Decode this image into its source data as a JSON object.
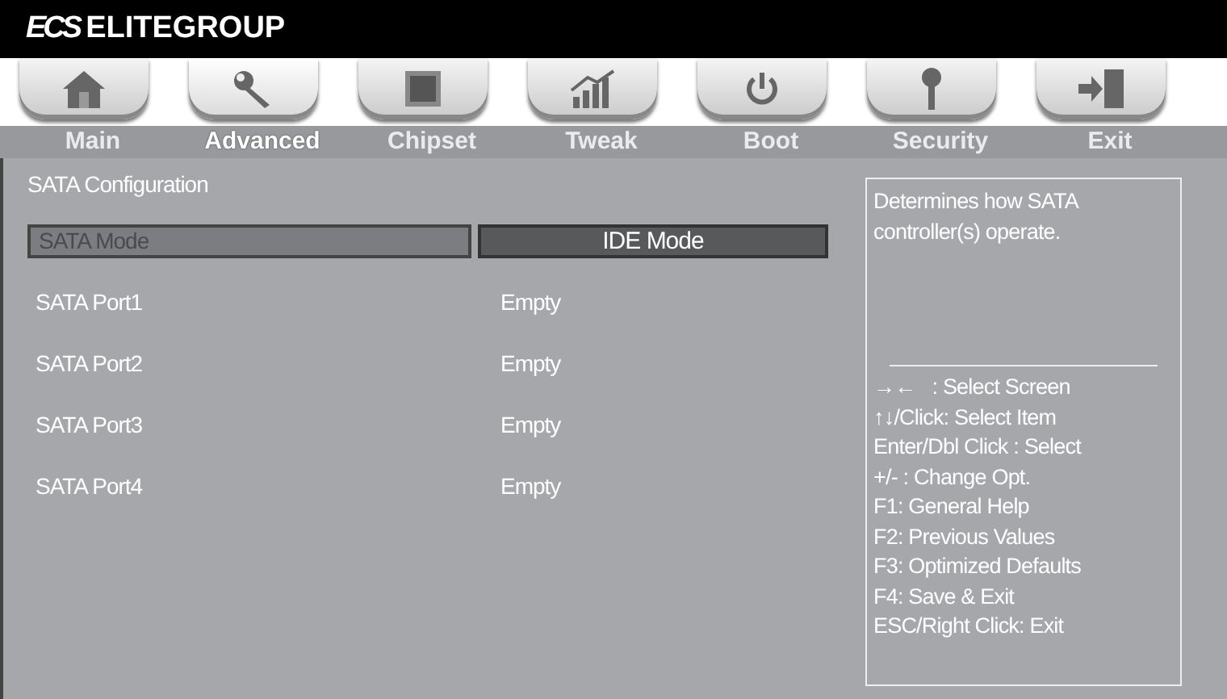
{
  "header": {
    "logo_mark": "ECS",
    "brand": "ELITEGROUP"
  },
  "tabs": [
    {
      "label": "Main",
      "selected": false
    },
    {
      "label": "Advanced",
      "selected": true
    },
    {
      "label": "Chipset",
      "selected": false
    },
    {
      "label": "Tweak",
      "selected": false
    },
    {
      "label": "Boot",
      "selected": false
    },
    {
      "label": "Security",
      "selected": false
    },
    {
      "label": "Exit",
      "selected": false
    }
  ],
  "section_title": "SATA Configuration",
  "settings": [
    {
      "label": "SATA Mode",
      "value": "IDE Mode",
      "selected": true
    },
    {
      "label": "SATA Port1",
      "value": "Empty",
      "selected": false
    },
    {
      "label": "SATA Port2",
      "value": "Empty",
      "selected": false
    },
    {
      "label": "SATA Port3",
      "value": "Empty",
      "selected": false
    },
    {
      "label": "SATA Port4",
      "value": "Empty",
      "selected": false
    }
  ],
  "help": {
    "description": "Determines how SATA controller(s) operate.",
    "keys": [
      "→←   : Select Screen",
      "↑↓/Click: Select Item",
      "Enter/Dbl Click : Select",
      "+/- : Change Opt.",
      "F1: General Help",
      "F2: Previous Values",
      "F3: Optimized Defaults",
      "F4: Save & Exit",
      "ESC/Right Click: Exit"
    ]
  }
}
